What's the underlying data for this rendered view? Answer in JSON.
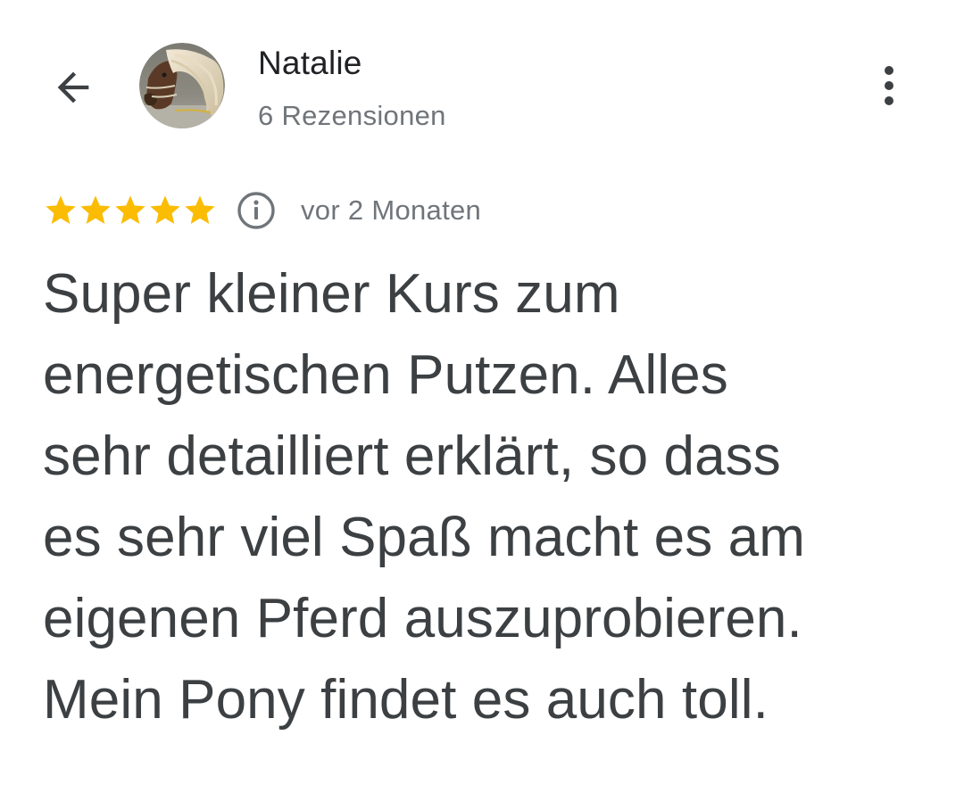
{
  "header": {
    "author_name": "Natalie",
    "review_count": "6 Rezensionen",
    "icons": {
      "back": "arrow-back-icon",
      "avatar": "horse-avatar",
      "more": "more-vert-icon"
    }
  },
  "review": {
    "rating": 5,
    "rating_max": 5,
    "star_color": "#fbbc04",
    "date": "vor 2 Monaten",
    "info_icon": "info-icon",
    "text": "Super kleiner Kurs zum\nenergetischen Putzen. Alles\nsehr detailliert erklärt, so dass\nes sehr viel Spaß macht es am\neigenen Pferd auszuprobieren.\nMein Pony findet es auch toll."
  }
}
